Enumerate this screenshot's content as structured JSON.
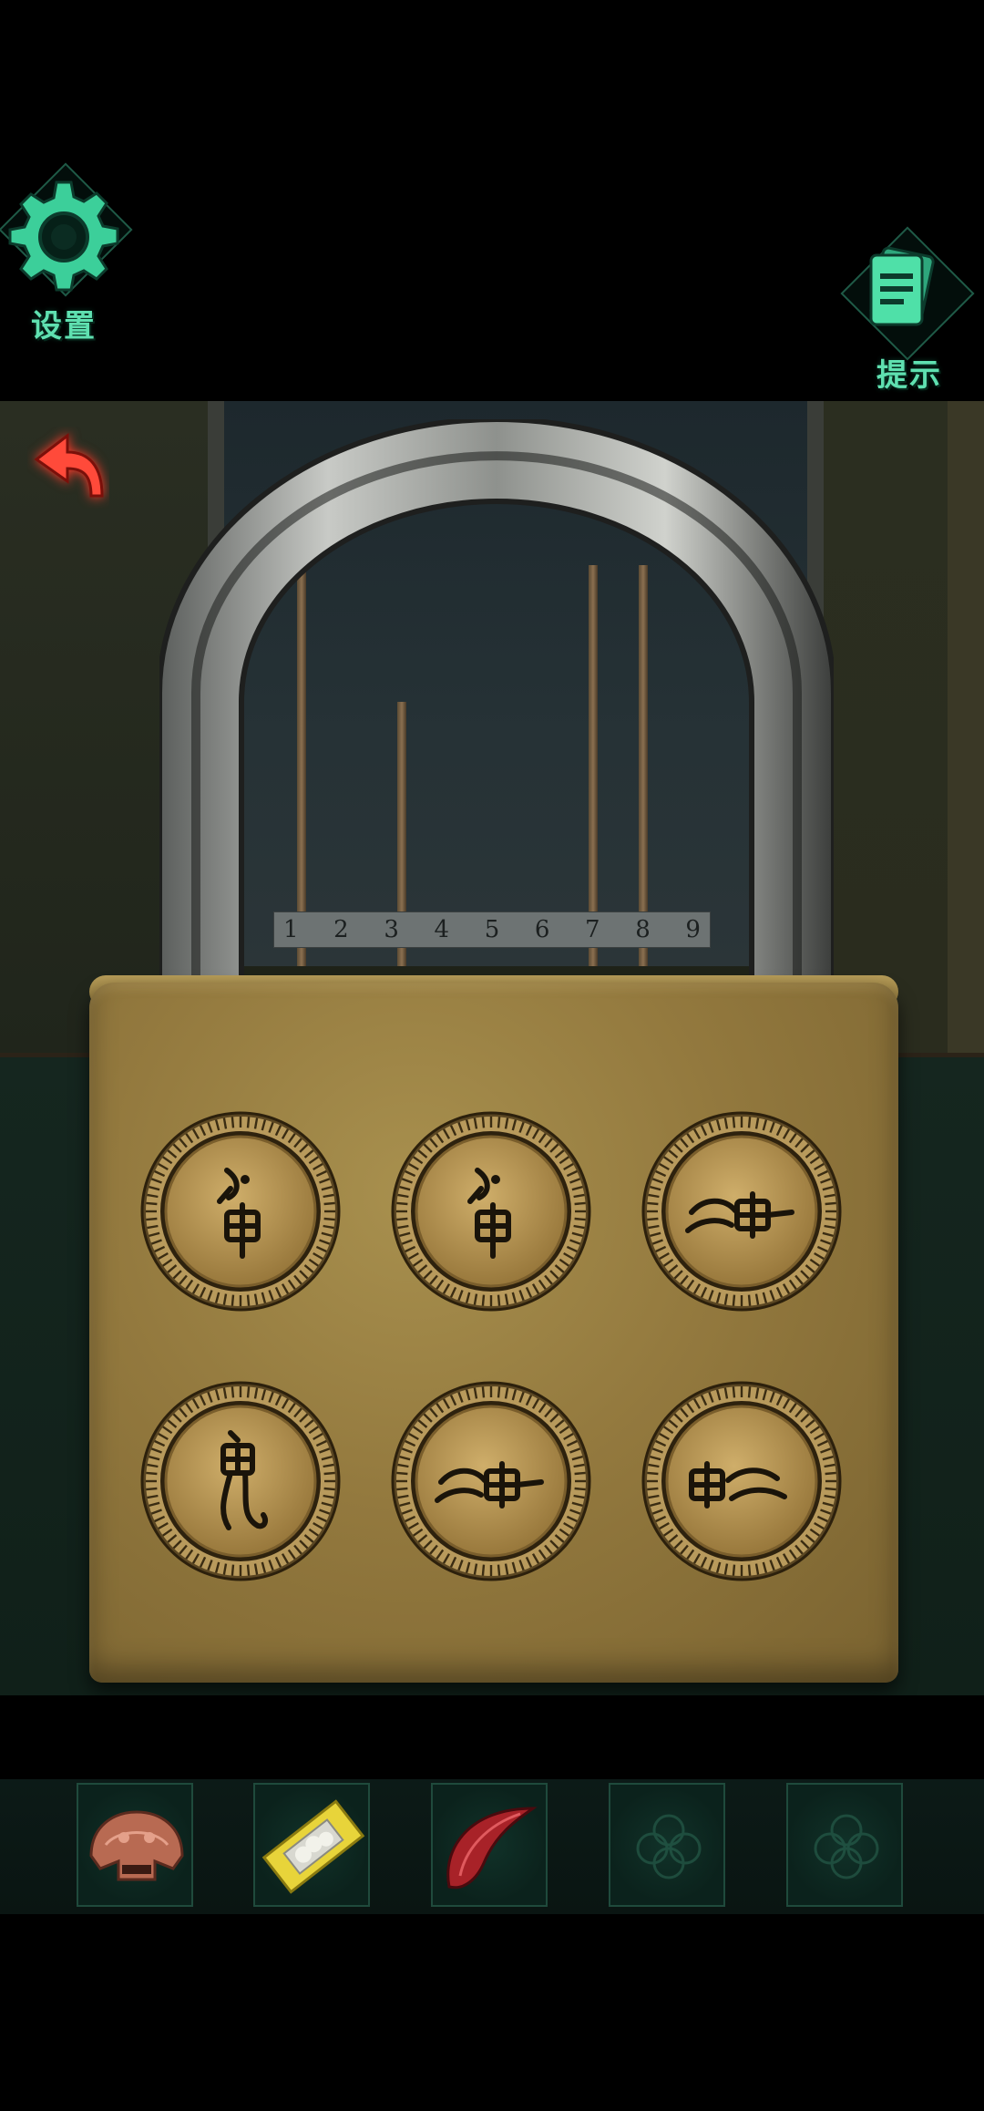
{
  "hud": {
    "settings_label": "设置",
    "hint_label": "提示",
    "accent_color": "#5fe0b0",
    "back_color": "#ff4a3a"
  },
  "icons": {
    "settings": "gear-icon",
    "hint": "document-icon",
    "back": "back-arrow-icon"
  },
  "ruler": {
    "numbers": [
      "1",
      "2",
      "3",
      "4",
      "5",
      "6",
      "7",
      "8",
      "9"
    ]
  },
  "lock": {
    "dials": [
      {
        "glyph": "seal-glyph-a"
      },
      {
        "glyph": "seal-glyph-a"
      },
      {
        "glyph": "seal-glyph-b"
      },
      {
        "glyph": "seal-glyph-ghost"
      },
      {
        "glyph": "seal-glyph-b"
      },
      {
        "glyph": "seal-glyph-c"
      }
    ]
  },
  "inventory": {
    "slots": [
      {
        "item": "carved-copper-token"
      },
      {
        "item": "gold-foil-packet"
      },
      {
        "item": "red-crescent-fragment"
      },
      {
        "item": "empty"
      },
      {
        "item": "empty"
      }
    ]
  }
}
